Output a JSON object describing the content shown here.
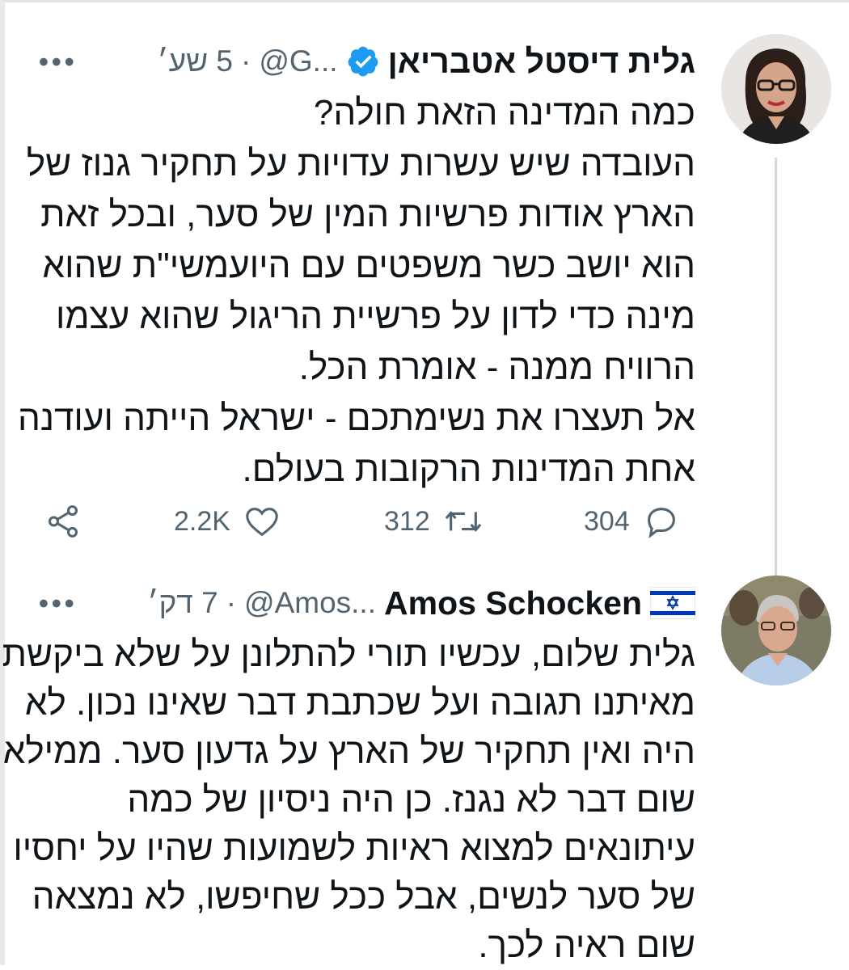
{
  "tweets": [
    {
      "author_name": "גלית דיסטל אטבריאן",
      "verified": true,
      "handle": "@G...",
      "separator": "·",
      "time": "5 שע׳",
      "more": "•••",
      "lines": [
        "כמה המדינה הזאת חולה?",
        "העובדה שיש עשרות עדויות על תחקיר גנוז של",
        "הארץ אודות פרשיות המין של סער, ובכל זאת",
        "הוא יושב כשר משפטים עם היועמשי\"ת שהוא",
        "מינה כדי לדון על פרשיית הריגול שהוא עצמו",
        "הרוויח ממנה - אומרת הכל.",
        "אל תעצרו את נשימתכם - ישראל הייתה ועודנה",
        "אחת המדינות הרקובות בעולם."
      ],
      "stats": {
        "replies": "304",
        "retweets": "312",
        "likes": "2.2K"
      }
    },
    {
      "author_name": "Amos Schocken",
      "flag": "israel-flag",
      "handle": "@Amos...",
      "separator": "·",
      "time": "7 דק׳",
      "more": "•••",
      "lines": [
        "גלית שלום, עכשיו תורי להתלונן על שלא ביקשת",
        "מאיתנו תגובה ועל שכתבת דבר שאינו נכון. לא",
        "היה ואין תחקיר של הארץ על גדעון סער. ממילא",
        "שום דבר לא נגנז. כן היה ניסיון של כמה",
        "עיתונאים למצוא ראיות לשמועות שהיו על יחסיו",
        "של סער לנשים, אבל ככל שחיפשו, לא נמצאה",
        "שום ראיה לכך."
      ]
    }
  ],
  "colors": {
    "verified": "#1d9bf0",
    "secondary_text": "#536471",
    "thread_line": "#cfd9de",
    "flag_blue": "#0038b8"
  }
}
